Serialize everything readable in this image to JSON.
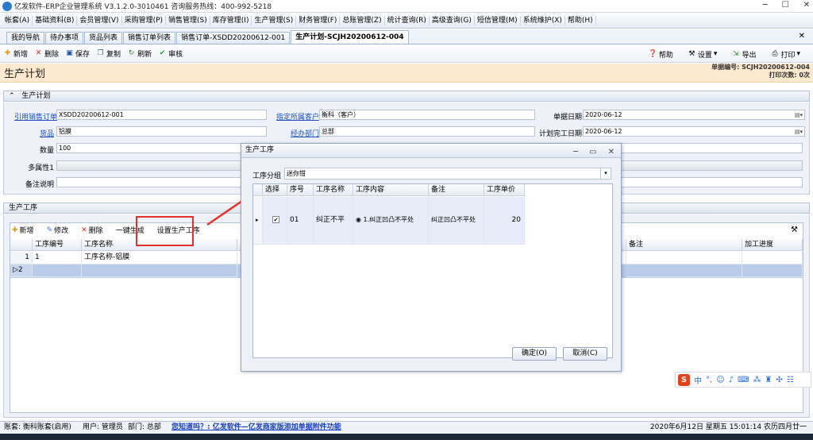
{
  "window": {
    "title": "亿发软件-ERP企业管理系统 V3.1.2.0-3010461 咨询服务热线：400-992-5218"
  },
  "menu": [
    "帐套(A)",
    "基础资料(B)",
    "会员管理(V)",
    "采购管理(P)",
    "销售管理(S)",
    "库存管理(I)",
    "生产管理(S)",
    "财务管理(F)",
    "总账管理(Z)",
    "统计查询(R)",
    "高级查询(G)",
    "短信管理(M)",
    "系统维护(X)",
    "帮助(H)"
  ],
  "tabs": [
    "我的导航",
    "待办事项",
    "货品列表",
    "销售订单列表",
    "销售订单-XSDD20200612-001",
    "生产计划-SCJH20200612-004"
  ],
  "toolbar": {
    "new": "新增",
    "delete": "删除",
    "save": "保存",
    "copy": "复制",
    "refresh": "刷新",
    "review": "审核",
    "help": "帮助",
    "settings": "设置",
    "export": "导出",
    "print": "打印"
  },
  "header": {
    "title": "生产计划",
    "doc_no": "单据编号: SCJH20200612-004",
    "print_count": "打印次数: 0次"
  },
  "form": {
    "section": "生产计划",
    "sales_order_label": "引用销售订单",
    "sales_order": "XSDD20200612-001",
    "customer_label": "指定所属客户",
    "customer": "衡科（客户）",
    "date_label": "单据日期",
    "date": "2020-06-12",
    "goods_label": "货品",
    "goods": "铝膜",
    "dept_label": "经办部门",
    "dept": "总部",
    "finish_label": "计划完工日期",
    "finish": "2020-06-12",
    "qty_label": "数量",
    "qty": "100",
    "attr_label": "多属性1",
    "note_label": "备注说明"
  },
  "process": {
    "section": "生产工序",
    "toolbar": {
      "add": "新增",
      "edit": "修改",
      "delete": "删除",
      "gen": "一键生成",
      "set": "设置生产工序"
    },
    "columns": [
      "工序编号",
      "工序名称",
      "备注",
      "加工进度"
    ],
    "rows": [
      {
        "no": "1",
        "code": "1",
        "name": "工序名称-铝膜"
      },
      {
        "no": "2",
        "code": "",
        "name": ""
      }
    ]
  },
  "dialog": {
    "title": "生产工序",
    "group_label": "工序分组",
    "group_value": "迷你钳",
    "columns": [
      "选择",
      "序号",
      "工序名称",
      "工序内容",
      "备注",
      "工序单价"
    ],
    "row": {
      "seq": "01",
      "name": "纠正不平",
      "content": "1.纠正凹凸不平处",
      "note": "纠正凹凸不平处",
      "price": "20"
    },
    "ok": "确定(O)",
    "cancel": "取消(C)"
  },
  "status": {
    "account": "账套: 衡科账套(启用)",
    "user": "用户: 管理员",
    "dept": "部门: 总部",
    "promo": "您知道吗？: 亿发软件—亿发商家版添加单据附件功能",
    "datetime": "2020年6月12日 星期五 15:01:14 农历四月廿一"
  },
  "ime": {
    "label": "中"
  }
}
